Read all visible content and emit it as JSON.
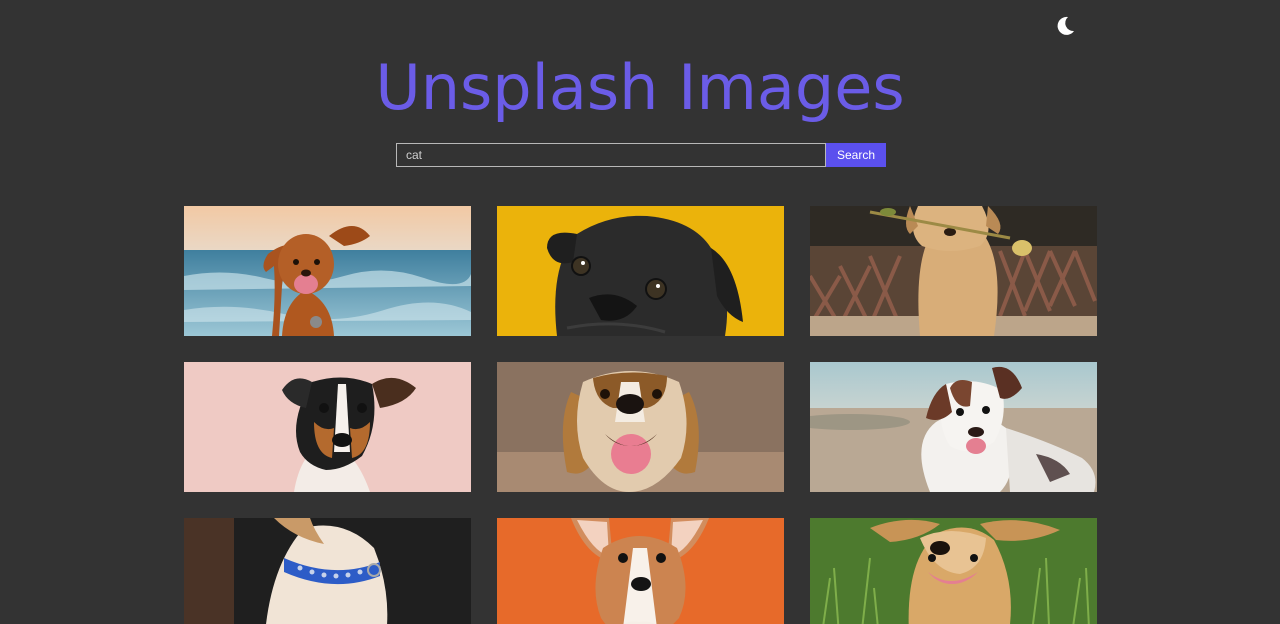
{
  "header": {
    "title": "Unsplash Images",
    "theme_toggle_icon": "moon-icon"
  },
  "search": {
    "value": "cat",
    "button_label": "Search"
  },
  "colors": {
    "background": "#333333",
    "title": "#6b5ce7",
    "button": "#5b50ee"
  },
  "gallery": {
    "images": [
      {
        "subject": "retriever dog by the sea",
        "icon": "dog-photo"
      },
      {
        "subject": "black pug on yellow background",
        "icon": "dog-photo"
      },
      {
        "subject": "golden puppy holding a flower",
        "icon": "dog-photo"
      },
      {
        "subject": "terrier on pink background",
        "icon": "dog-photo"
      },
      {
        "subject": "smiling beagle",
        "icon": "dog-photo"
      },
      {
        "subject": "australian shepherd on beach",
        "icon": "dog-photo"
      },
      {
        "subject": "dog with blue collar",
        "icon": "dog-photo"
      },
      {
        "subject": "corgi puppy on orange background",
        "icon": "dog-photo"
      },
      {
        "subject": "dog lying in grass",
        "icon": "dog-photo"
      }
    ]
  }
}
